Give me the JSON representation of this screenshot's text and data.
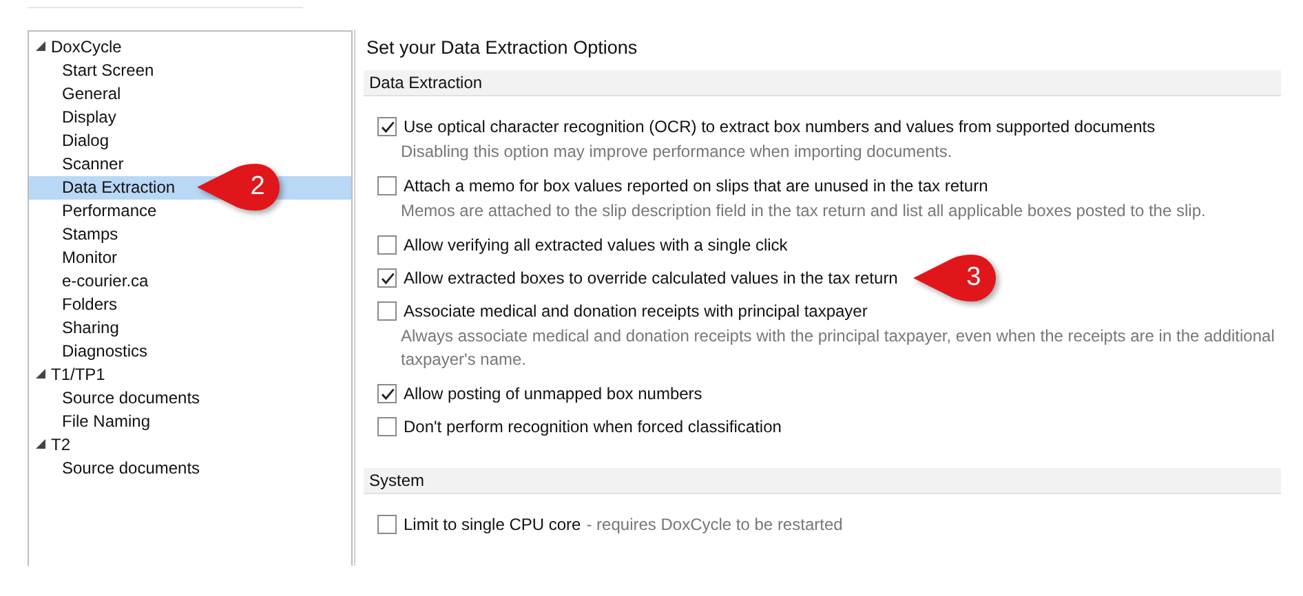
{
  "tree": [
    {
      "label": "DoxCycle",
      "expanded": true,
      "selected": false,
      "children": [
        {
          "label": "Start Screen",
          "selected": false
        },
        {
          "label": "General",
          "selected": false
        },
        {
          "label": "Display",
          "selected": false
        },
        {
          "label": "Dialog",
          "selected": false
        },
        {
          "label": "Scanner",
          "selected": false
        },
        {
          "label": "Data Extraction",
          "selected": true,
          "callout": "2"
        },
        {
          "label": "Performance",
          "selected": false
        },
        {
          "label": "Stamps",
          "selected": false
        },
        {
          "label": "Monitor",
          "selected": false
        },
        {
          "label": "e-courier.ca",
          "selected": false
        },
        {
          "label": "Folders",
          "selected": false
        },
        {
          "label": "Sharing",
          "selected": false
        },
        {
          "label": "Diagnostics",
          "selected": false
        }
      ]
    },
    {
      "label": "T1/TP1",
      "expanded": true,
      "selected": false,
      "children": [
        {
          "label": "Source documents",
          "selected": false
        },
        {
          "label": "File Naming",
          "selected": false
        }
      ]
    },
    {
      "label": "T2",
      "expanded": true,
      "selected": false,
      "children": [
        {
          "label": "Source documents",
          "selected": false
        }
      ]
    }
  ],
  "page_title": "Set your Data Extraction Options",
  "sections": [
    {
      "title": "Data Extraction",
      "options": [
        {
          "label": "Use optical character recognition (OCR) to extract box numbers and values from supported documents",
          "checked": true,
          "hint": "Disabling this option may improve performance when importing documents."
        },
        {
          "label": "Attach a memo for box values reported on slips that are unused in the tax return",
          "checked": false,
          "hint": "Memos are attached to the slip description field in the tax return and list all applicable boxes posted to the slip."
        },
        {
          "label": "Allow verifying all extracted values with a single click",
          "checked": false
        },
        {
          "label": "Allow extracted boxes to override calculated values in the tax return",
          "checked": true,
          "callout": "3"
        },
        {
          "label": "Associate medical and donation receipts with principal taxpayer",
          "checked": false,
          "hint": "Always associate medical and donation receipts with the principal taxpayer, even when the receipts are in the additional taxpayer's name."
        },
        {
          "label": "Allow posting of unmapped box numbers",
          "checked": true
        },
        {
          "label": "Don't perform recognition when forced classification",
          "checked": false
        }
      ]
    },
    {
      "title": "System",
      "options": [
        {
          "label": "Limit to single CPU core",
          "note": "- requires DoxCycle to be restarted",
          "checked": false
        }
      ]
    }
  ]
}
